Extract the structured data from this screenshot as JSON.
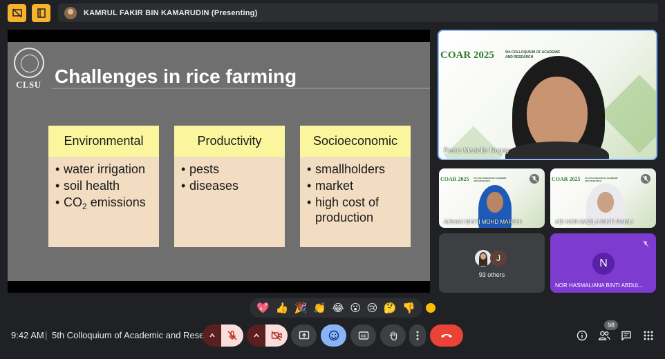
{
  "presenter_bar": {
    "name": "KAMRUL FAKIR BIN KAMARUDIN (Presenting)"
  },
  "slide": {
    "logo_text": "CLSU",
    "title": "Challenges in rice farming",
    "columns": [
      {
        "heading": "Environmental",
        "items": [
          {
            "text": "water irrigation"
          },
          {
            "text": "soil health"
          },
          {
            "prefix": "CO",
            "sub": "2",
            "suffix": " emissions"
          }
        ]
      },
      {
        "heading": "Productivity",
        "items": [
          {
            "text": "pests"
          },
          {
            "text": "diseases"
          }
        ]
      },
      {
        "heading": "Socioeconomic",
        "items": [
          {
            "text": "smallholders"
          },
          {
            "text": "market"
          },
          {
            "text": "high cost of production"
          }
        ]
      }
    ]
  },
  "tiles": {
    "main": {
      "name": "Franz Marielle Nogoy",
      "conf_title": "COAR 2025",
      "conf_line1": "5th COLLOQUIUM OF ACADEMIC",
      "conf_line2": "AND RESEARCH"
    },
    "small1": {
      "name": "AISHAH BINTI MOHD MARSHI",
      "conf_title": "COAR 2025",
      "conf_line1": "5th COLLOQUIUM OF ACADEMIC",
      "conf_line2": "AND RESEARCH"
    },
    "small2": {
      "name": "AEI NOR MAZILA BINTI RAMLI",
      "conf_title": "COAR 2025",
      "conf_line1": "5th COLLOQUIUM OF ACADEMIC",
      "conf_line2": "AND RESEARCH"
    },
    "others": {
      "label": "93 others",
      "avatar_letter": "J"
    },
    "nor": {
      "initial": "N",
      "name": "NOR HASMALIANA BINTI ABDUL..."
    }
  },
  "reactions": [
    "💖",
    "👍",
    "🎉",
    "👏",
    "😂",
    "😮",
    "😢",
    "🤔",
    "👎"
  ],
  "bottom_bar": {
    "time": "9:42 AM",
    "separator": "|",
    "meeting_title": "5th Colloquium of Academic and Resea...",
    "participants_count": "98"
  },
  "colors": {
    "background": "#202124",
    "accent_yellow": "#f6b32b",
    "mic_off_red": "#f28b82",
    "end_call_red": "#ea4335",
    "reaction_active_blue": "#8ab4f8",
    "nor_tile_purple": "#7e3bd0"
  },
  "icons": [
    "present-off-icon",
    "book-icon",
    "mic-off-icon",
    "camera-off-icon",
    "present-screen-icon",
    "emoji-icon",
    "captions-icon",
    "raise-hand-icon",
    "more-options-icon",
    "end-call-icon",
    "info-icon",
    "people-icon",
    "chat-icon",
    "activities-icon"
  ]
}
